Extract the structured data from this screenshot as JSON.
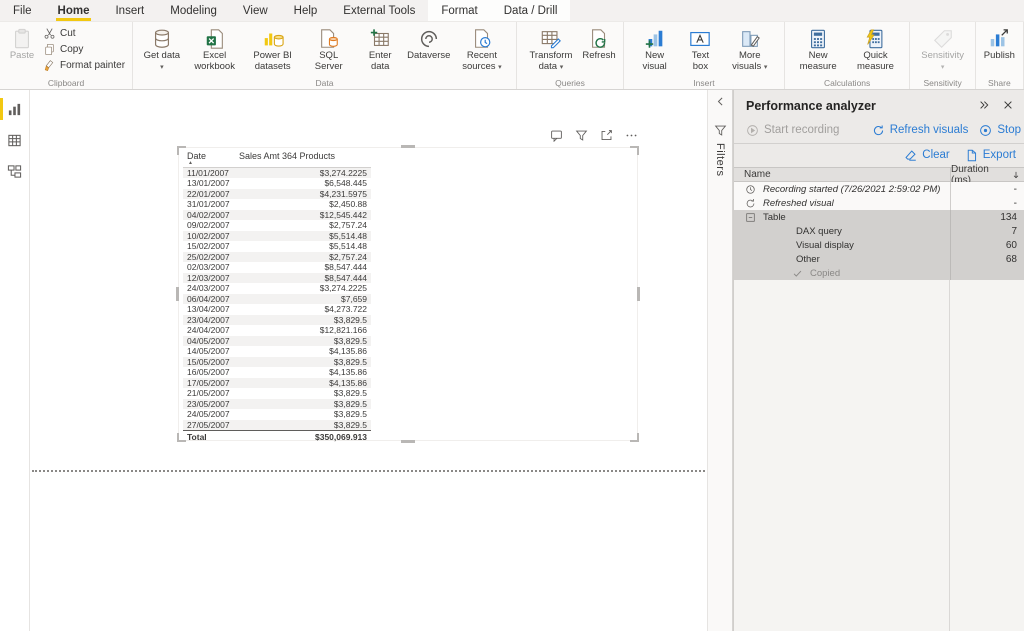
{
  "menu": {
    "tabs": [
      {
        "label": "File"
      },
      {
        "label": "Home",
        "active": true
      },
      {
        "label": "Insert"
      },
      {
        "label": "Modeling"
      },
      {
        "label": "View"
      },
      {
        "label": "Help"
      },
      {
        "label": "External Tools"
      },
      {
        "label": "Format",
        "contextual": true
      },
      {
        "label": "Data / Drill",
        "contextual": true
      }
    ]
  },
  "ribbon": {
    "clipboard": {
      "label": "Clipboard",
      "paste": "Paste",
      "cut": "Cut",
      "copy": "Copy",
      "format_painter": "Format painter"
    },
    "groups": [
      {
        "label": "Data",
        "items": [
          {
            "label": "Get data",
            "icon": "get-data-icon",
            "dropdown": true
          },
          {
            "label": "Excel workbook",
            "icon": "excel-workbook-icon"
          },
          {
            "label": "Power BI datasets",
            "icon": "powerbi-datasets-icon"
          },
          {
            "label": "SQL Server",
            "icon": "sql-server-icon"
          },
          {
            "label": "Enter data",
            "icon": "enter-data-icon"
          },
          {
            "label": "Dataverse",
            "icon": "dataverse-icon"
          },
          {
            "label": "Recent sources",
            "icon": "recent-sources-icon",
            "dropdown": true
          }
        ]
      },
      {
        "label": "Queries",
        "items": [
          {
            "label": "Transform data",
            "icon": "transform-data-icon",
            "dropdown": true
          },
          {
            "label": "Refresh",
            "icon": "refresh-data-icon"
          }
        ]
      },
      {
        "label": "Insert",
        "items": [
          {
            "label": "New visual",
            "icon": "new-visual-icon"
          },
          {
            "label": "Text box",
            "icon": "text-box-icon"
          },
          {
            "label": "More visuals",
            "icon": "more-visuals-icon",
            "dropdown": true
          }
        ]
      },
      {
        "label": "Calculations",
        "items": [
          {
            "label": "New measure",
            "icon": "new-measure-icon"
          },
          {
            "label": "Quick measure",
            "icon": "quick-measure-icon"
          }
        ]
      },
      {
        "label": "Sensitivity",
        "items": [
          {
            "label": "Sensitivity",
            "icon": "sensitivity-icon",
            "dropdown": true,
            "disabled": true
          }
        ]
      },
      {
        "label": "Share",
        "items": [
          {
            "label": "Publish",
            "icon": "publish-icon"
          }
        ]
      }
    ]
  },
  "side_rail": {
    "items": [
      {
        "icon": "report-view-icon",
        "active": true
      },
      {
        "icon": "data-view-icon"
      },
      {
        "icon": "model-view-icon"
      }
    ]
  },
  "visual": {
    "columns": {
      "date": "Date",
      "amount": "Sales Amt 364 Products"
    },
    "sort_indicator": "▲",
    "rows": [
      [
        "11/01/2007",
        "$3,274.2225"
      ],
      [
        "13/01/2007",
        "$6,548.445"
      ],
      [
        "22/01/2007",
        "$4,231.5975"
      ],
      [
        "31/01/2007",
        "$2,450.88"
      ],
      [
        "04/02/2007",
        "$12,545.442"
      ],
      [
        "09/02/2007",
        "$2,757.24"
      ],
      [
        "10/02/2007",
        "$5,514.48"
      ],
      [
        "15/02/2007",
        "$5,514.48"
      ],
      [
        "25/02/2007",
        "$2,757.24"
      ],
      [
        "02/03/2007",
        "$8,547.444"
      ],
      [
        "12/03/2007",
        "$8,547.444"
      ],
      [
        "24/03/2007",
        "$3,274.2225"
      ],
      [
        "06/04/2007",
        "$7,659"
      ],
      [
        "13/04/2007",
        "$4,273.722"
      ],
      [
        "23/04/2007",
        "$3,829.5"
      ],
      [
        "24/04/2007",
        "$12,821.166"
      ],
      [
        "04/05/2007",
        "$3,829.5"
      ],
      [
        "14/05/2007",
        "$4,135.86"
      ],
      [
        "15/05/2007",
        "$3,829.5"
      ],
      [
        "16/05/2007",
        "$4,135.86"
      ],
      [
        "17/05/2007",
        "$4,135.86"
      ],
      [
        "21/05/2007",
        "$3,829.5"
      ],
      [
        "23/05/2007",
        "$3,829.5"
      ],
      [
        "24/05/2007",
        "$3,829.5"
      ],
      [
        "27/05/2007",
        "$3,829.5"
      ]
    ],
    "total_label": "Total",
    "total_value": "$350,069.913"
  },
  "filters": {
    "label": "Filters"
  },
  "pa": {
    "title": "Performance analyzer",
    "start_recording": "Start recording",
    "refresh_visuals": "Refresh visuals",
    "stop": "Stop",
    "clear": "Clear",
    "export": "Export",
    "name_header": "Name",
    "duration_header": "Duration (ms)",
    "rows": [
      {
        "icon": "clock-icon",
        "label": "Recording started (7/26/2021 2:59:02 PM)",
        "duration": "-",
        "italic": true
      },
      {
        "icon": "refreshed-icon",
        "label": "Refreshed visual",
        "duration": "-",
        "italic": true
      },
      {
        "icon": "collapse-row-icon",
        "label": "Table",
        "duration": "134",
        "selected": true
      },
      {
        "label": "DAX query",
        "duration": "7",
        "selected": true,
        "indent": true
      },
      {
        "label": "Visual display",
        "duration": "60",
        "selected": true,
        "indent": true
      },
      {
        "label": "Other",
        "duration": "68",
        "selected": true,
        "indent": true
      },
      {
        "icon": "check-icon",
        "label": "Copied",
        "duration": "",
        "selected": true,
        "indent2": true,
        "muted": true
      }
    ]
  },
  "colors": {
    "accent_yellow": "#f2c811",
    "link_blue": "#2b7cd3"
  }
}
